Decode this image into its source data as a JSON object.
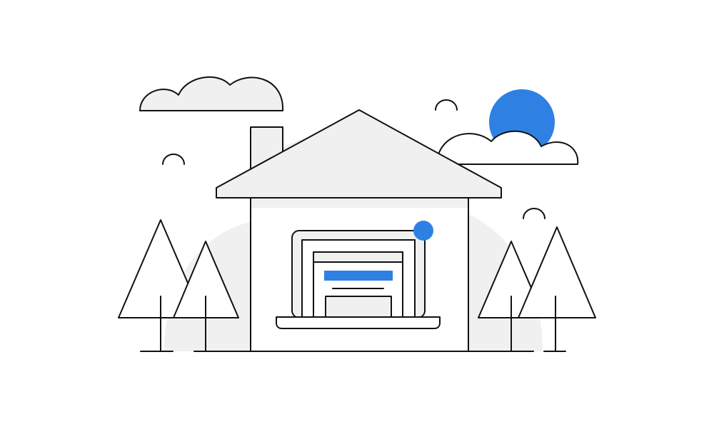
{
  "illustration": {
    "subject": "house-with-laptop",
    "colors": {
      "background": "#ffffff",
      "stroke": "#111111",
      "fill_light": "#f0f0f0",
      "accent": "#2f80e3"
    },
    "icons": [
      "cloud-icon",
      "sun-icon",
      "bird-icon",
      "house-icon",
      "chimney-icon",
      "laptop-icon",
      "notification-dot-icon",
      "tree-icon"
    ]
  }
}
